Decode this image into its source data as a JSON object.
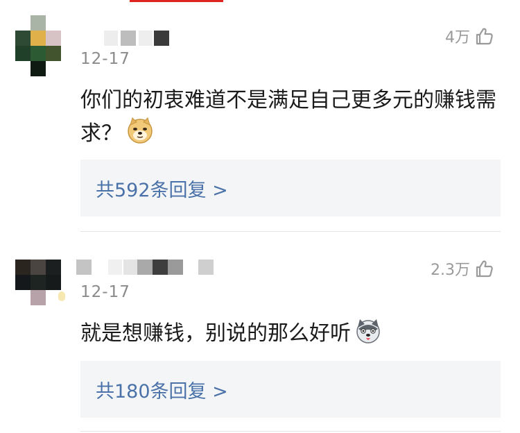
{
  "comments": [
    {
      "date": "12-17",
      "likes": "4万",
      "text": "你们的初衷难道不是满足自己更多元的赚钱需求？",
      "emoji_icon": "doge-emoji",
      "replies_label": "共592条回复 >"
    },
    {
      "date": "12-17",
      "likes": "2.3万",
      "text": "就是想赚钱，别说的那么好听",
      "emoji_icon": "husky-emoji",
      "replies_label": "共180条回复 >"
    }
  ],
  "colors": {
    "accent": "#e0241f",
    "link": "#4a72a8",
    "muted": "#8a8a8a",
    "reply_bg": "#f4f5f7"
  }
}
